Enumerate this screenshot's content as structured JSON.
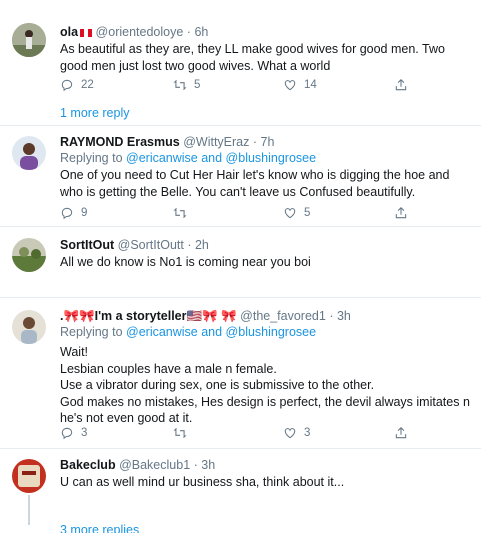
{
  "tweets": [
    {
      "name": "ola",
      "handle": "@orientedoloye",
      "time": "6h",
      "reply_prefix": "",
      "reply_users": "",
      "text": "As beautiful as they are, they LL make good wives for good men. Two good men just lost two good wives. What a world",
      "replies": "22",
      "retweets": "5",
      "likes": "14"
    },
    {
      "name": "RAYMOND Erasmus",
      "handle": "@WittyEraz",
      "time": "7h",
      "reply_prefix": "Replying to ",
      "reply_users": "@ericanwise and @blushingrosee",
      "text": "One of you need to Cut Her Hair let's know who is digging the hoe and who is getting the Belle. You can't leave us Confused beautifully.",
      "replies": "9",
      "retweets": "",
      "likes": "5"
    },
    {
      "name": "SortItOut",
      "handle": "@SortItOutt",
      "time": "2h",
      "reply_prefix": "",
      "reply_users": "",
      "text": "All we do know is No1 is coming near you boi",
      "replies": "",
      "retweets": "",
      "likes": ""
    },
    {
      "name": ".🎀🎀I'm a storyteller🇺🇸🎀 🎀",
      "handle": "@the_favored1",
      "time": "3h",
      "reply_prefix": "Replying to ",
      "reply_users": "@ericanwise and @blushingrosee",
      "text": "Wait!\nLesbian couples have a male n female.\nUse a vibrator during sex, one is submissive to the other.\nGod makes no mistakes, Hes design is perfect, the devil always imitates n he's not even good at it.",
      "replies": "3",
      "retweets": "",
      "likes": "3"
    },
    {
      "name": "Bakeclub",
      "handle": "@Bakeclub1",
      "time": "3h",
      "reply_prefix": "",
      "reply_users": "",
      "text": "U can as well mind ur business sha, think about it...",
      "replies": "",
      "retweets": "",
      "likes": ""
    }
  ],
  "more_replies_1": "1 more reply",
  "more_replies_2": "3 more replies",
  "colors": {
    "accent": "#1b95e0",
    "muted": "#657786",
    "divider": "#e6ecf0"
  }
}
